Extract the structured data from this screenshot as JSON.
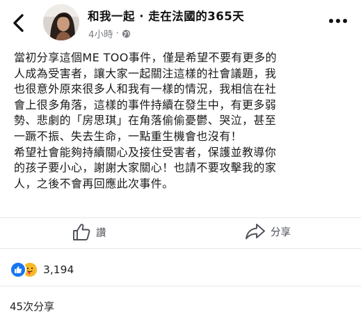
{
  "header": {
    "page_name": "和我一起 · 走在法國的365天",
    "timestamp": "4小時",
    "privacy_icon": "globe-icon",
    "back_icon": "chevron-left-icon",
    "more_icon": "more-horizontal-icon"
  },
  "post": {
    "text": "當初分享這個ME TOO事件，僅是希望不要有更多的\n人成為受害者，讓大家一起關注這樣的社會議題，我\n也很意外原來很多人和我有一樣的情況，我相信在社\n會上很多角落，這樣的事件持續在發生中，有更多弱\n勢、悲劇的「房思琪」在角落偷偷憂鬱、哭泣，甚至\n一蹶不振、失去生命，一點重生機會也沒有！\n希望社會能夠持續關心及接住受害者，保護並教導你\n的孩子要小心，謝謝大家關心！也請不要攻擊我的家\n人，之後不會再回應此次事件。"
  },
  "actions": {
    "like_label": "讚",
    "share_label": "分享"
  },
  "stats": {
    "reaction_count": "3,194",
    "share_count": "45次分享",
    "reaction_icons": [
      "like-icon",
      "care-icon"
    ]
  },
  "colors": {
    "like_blue": "#1877f2",
    "care_yellow": "#f7b928",
    "secondary_text": "#7a7d82"
  }
}
